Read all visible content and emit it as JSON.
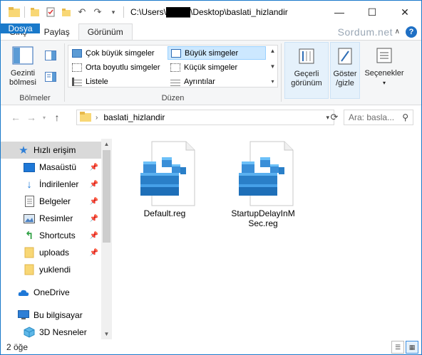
{
  "window": {
    "title": "C:\\Users\\████\\Desktop\\baslati_hizlandir",
    "controls": [
      "minimize",
      "maximize",
      "close"
    ]
  },
  "tabs": [
    {
      "label": "Dosya"
    },
    {
      "label": "Giriş"
    },
    {
      "label": "Paylaş"
    },
    {
      "label": "Görünüm"
    }
  ],
  "brand": "Sordum.net",
  "ribbon": {
    "panes": {
      "label": "Gezinti\nbölmesi",
      "group": "Bölmeler"
    },
    "layout": {
      "items": [
        "Çok büyük simgeler",
        "Büyük simgeler",
        "Orta boyutlu simgeler",
        "Küçük simgeler",
        "Listele",
        "Ayrıntılar"
      ],
      "selected": "Büyük simgeler",
      "group": "Düzen"
    },
    "current_view": "Geçerli\ngörünüm",
    "show_hide": "Göster\n/gizle",
    "options": "Seçenekler"
  },
  "address": {
    "path": "baslati_hizlandir",
    "search_placeholder": "Ara: basla..."
  },
  "nav": {
    "quick_access": "Hızlı erişim",
    "items": [
      {
        "label": "Masaüstü",
        "pinned": true
      },
      {
        "label": "İndirilenler",
        "pinned": true
      },
      {
        "label": "Belgeler",
        "pinned": true
      },
      {
        "label": "Resimler",
        "pinned": true
      },
      {
        "label": "Shortcuts",
        "pinned": true
      },
      {
        "label": "uploads",
        "pinned": true
      },
      {
        "label": "yuklendi",
        "pinned": false
      }
    ],
    "onedrive": "OneDrive",
    "this_pc": "Bu bilgisayar",
    "objects3d": "3D Nesneler"
  },
  "files": [
    {
      "name": "Default.reg",
      "icon": "registry-file-icon"
    },
    {
      "name": "StartupDelayInM\nSec.reg",
      "icon": "registry-file-icon"
    }
  ],
  "status": {
    "count": "2 öğe"
  }
}
